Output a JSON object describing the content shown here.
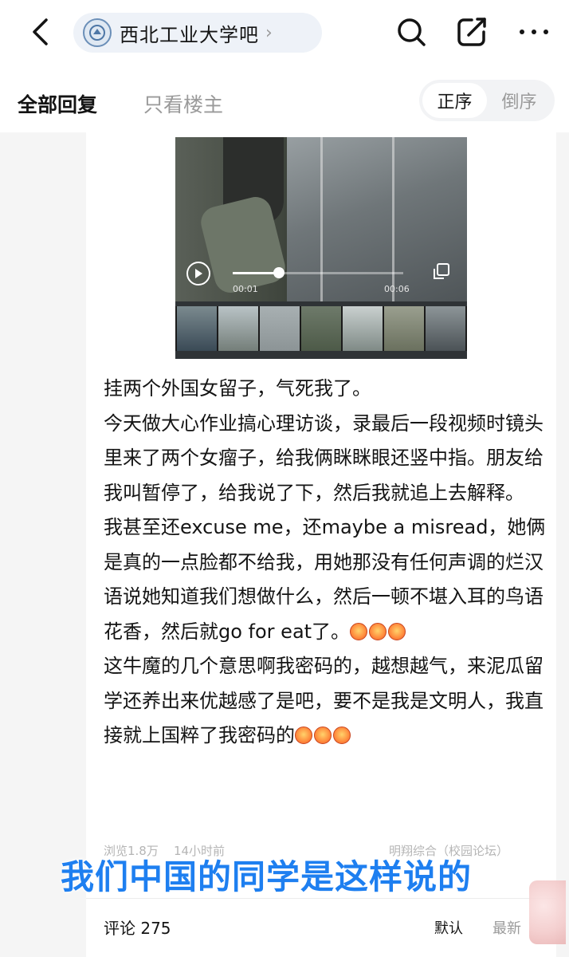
{
  "nav": {
    "forum_name": "西北工业大学吧"
  },
  "tabs": {
    "all_replies": "全部回复",
    "op_only": "只看楼主",
    "sort_asc": "正序",
    "sort_desc": "倒序"
  },
  "video": {
    "current_time": "00:01",
    "duration": "00:06",
    "progress": 0.27
  },
  "post": {
    "paragraphs": [
      "挂两个外国女留子，气死我了。",
      "今天做大心作业搞心理访谈，录最后一段视频时镜头里来了两个女瘤子，给我俩眯眯眼还竖中指。朋友给我叫暂停了，给我说了下，然后我就追上去解释。",
      "我甚至还excuse me，还maybe a misread，她俩是真的一点脸都不给我，用她那没有任何声调的烂汉语说她知道我们想做什么，然后一顿不堪入耳的鸟语花香，然后就go for eat了。",
      "这牛魔的几个意思啊我密码的，越想越气，来泥瓜留学还养出来优越感了是吧，要不是我是文明人，我直接就上国粹了我密码的"
    ]
  },
  "meta": {
    "views": "浏览1.8万",
    "time": "14小时前",
    "source": "明翔综合（校园论坛）"
  },
  "overlay_caption": "我们中国的同学是这样说的",
  "comments": {
    "label": "评论 275",
    "sort_default": "默认",
    "sort_latest": "最新"
  },
  "colors": {
    "caption_blue": "#1e7ff0",
    "page_bg": "#f5f5f5",
    "pill_bg": "#eef2f8"
  },
  "icons": [
    "back-arrow-icon",
    "forum-logo-icon",
    "chevron-right-icon",
    "search-icon",
    "share-icon",
    "more-icon",
    "play-icon",
    "fullscreen-icon",
    "emoji-angry-icon"
  ]
}
